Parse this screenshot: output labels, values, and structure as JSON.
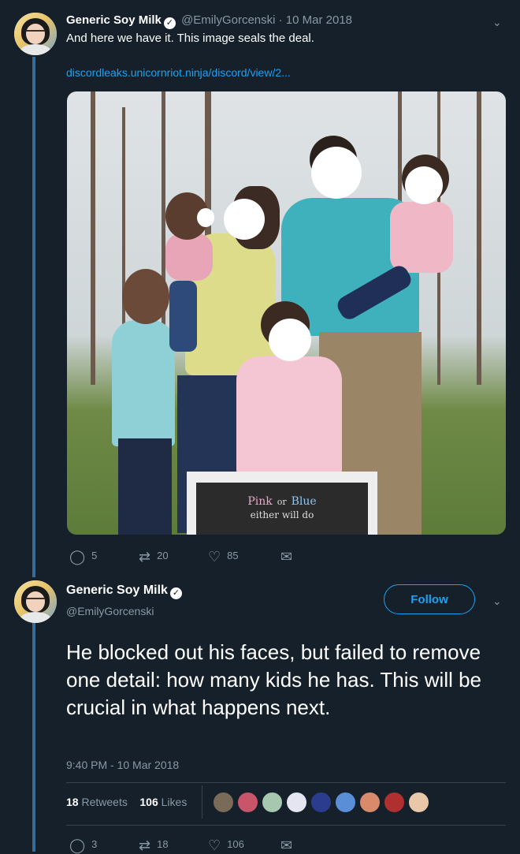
{
  "tweet1": {
    "name": "Generic Soy Milk",
    "handle_date": "@EmilyGorcenski · 10 Mar 2018",
    "text": "And here we have it. This image seals the deal.",
    "link": "discordleaks.unicornriot.ninja/discord/view/2...",
    "sign_text_pink": "Pink",
    "sign_text_or": "or",
    "sign_text_blue": "Blue",
    "sign_text_line2": "either will do",
    "actions": {
      "replies": "5",
      "retweets": "20",
      "likes": "85"
    }
  },
  "tweet2": {
    "name": "Generic Soy Milk",
    "handle": "@EmilyGorcenski",
    "follow_label": "Follow",
    "body": "He blocked out his faces, but failed to remove one detail: how many kids he has. This will be crucial in what happens next.",
    "timestamp": "9:40 PM - 10 Mar 2018",
    "retweets_count": "18",
    "retweets_label": "Retweets",
    "likes_count": "106",
    "likes_label": "Likes",
    "actions": {
      "replies": "3",
      "retweets": "18",
      "likes": "106"
    }
  },
  "icons": {
    "verified": "check-icon",
    "chevron": "chevron-down-icon",
    "reply": "reply-icon",
    "retweet": "retweet-icon",
    "like": "heart-icon",
    "message": "envelope-icon"
  },
  "colors": {
    "background": "#15202b",
    "accent": "#1da1f2",
    "muted": "#8899a6",
    "thread_line": "#3a6b94"
  }
}
